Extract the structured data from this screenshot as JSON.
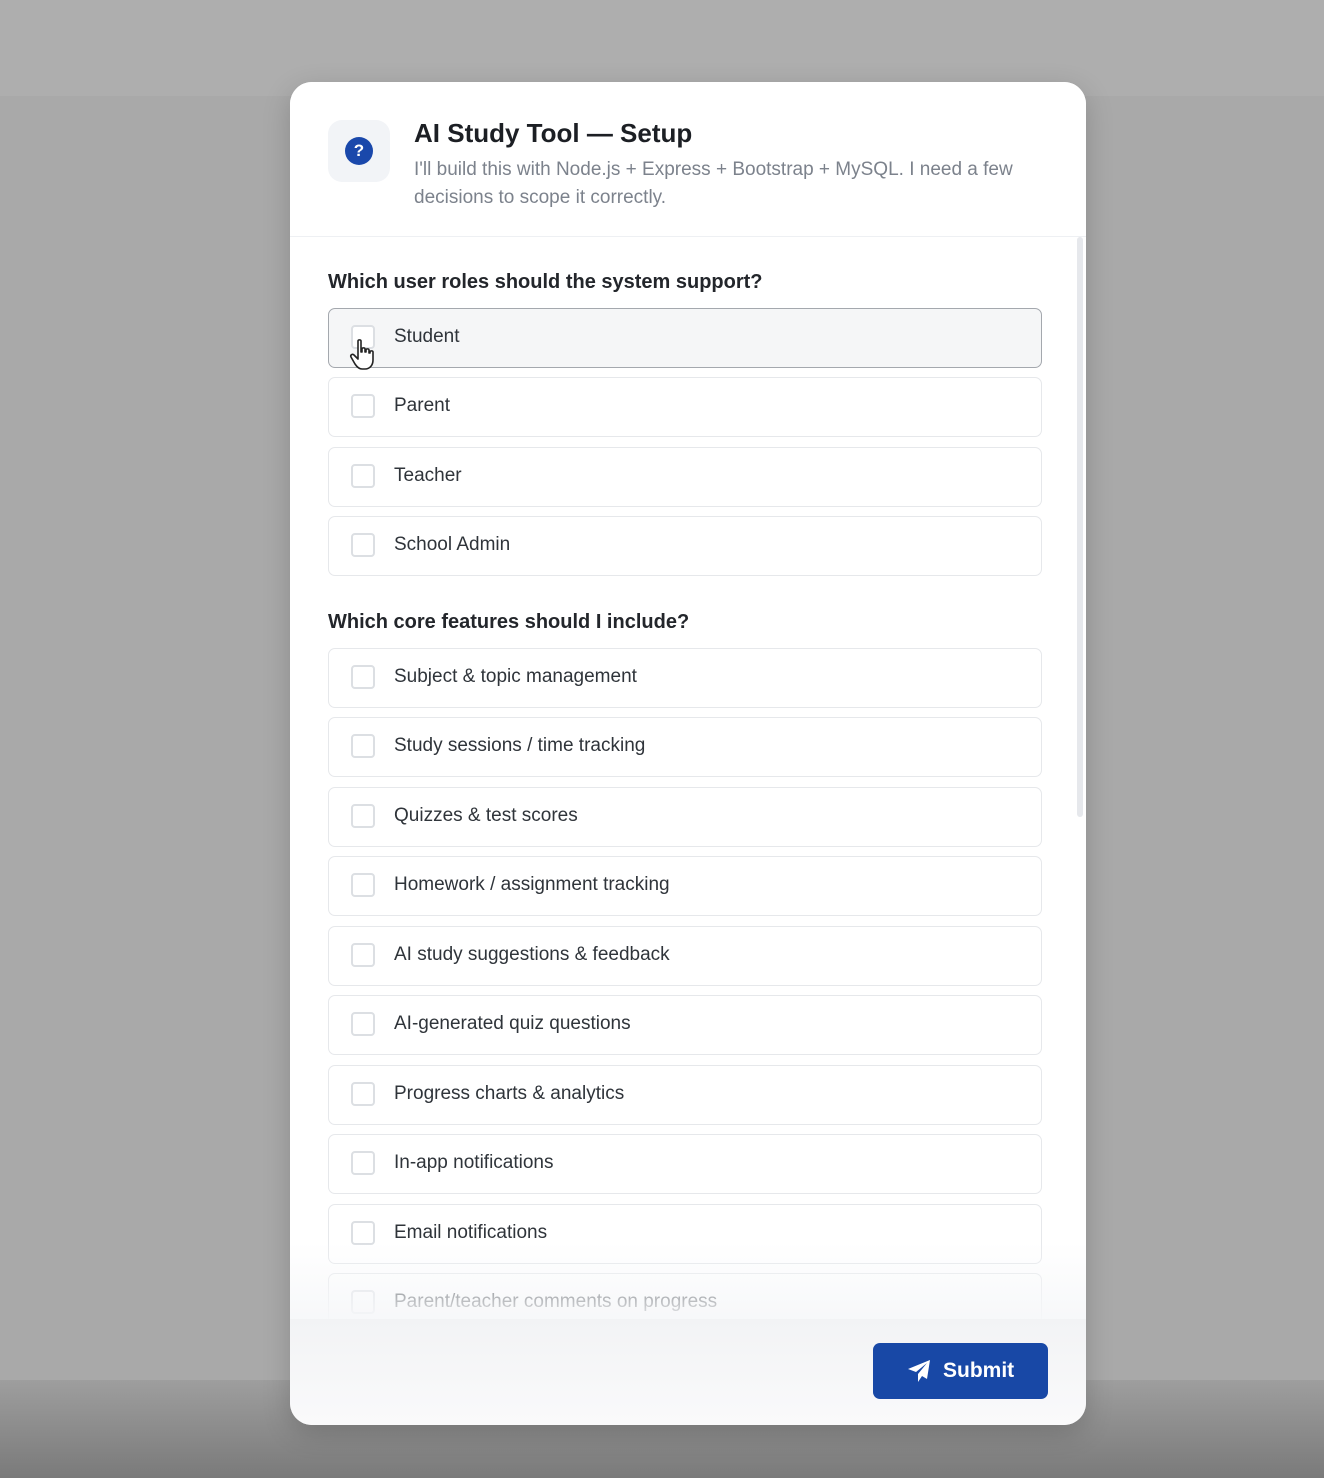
{
  "dialog": {
    "title": "AI Study Tool — Setup",
    "subtitle": "I'll build this with Node.js + Express + Bootstrap + MySQL. I need a few decisions to scope it correctly.",
    "icon": "question-circle-icon",
    "accent_color": "#1848a6"
  },
  "questions": [
    {
      "text": "Which user roles should the system support?",
      "options": [
        {
          "label": "Student",
          "checked": false
        },
        {
          "label": "Parent",
          "checked": false
        },
        {
          "label": "Teacher",
          "checked": false
        },
        {
          "label": "School Admin",
          "checked": false
        }
      ]
    },
    {
      "text": "Which core features should I include?",
      "options": [
        {
          "label": "Subject & topic management",
          "checked": false
        },
        {
          "label": "Study sessions / time tracking",
          "checked": false
        },
        {
          "label": "Quizzes & test scores",
          "checked": false
        },
        {
          "label": "Homework / assignment tracking",
          "checked": false
        },
        {
          "label": "AI study suggestions & feedback",
          "checked": false
        },
        {
          "label": "AI-generated quiz questions",
          "checked": false
        },
        {
          "label": "Progress charts & analytics",
          "checked": false
        },
        {
          "label": "In-app notifications",
          "checked": false
        },
        {
          "label": "Email notifications",
          "checked": false
        },
        {
          "label": "Parent/teacher comments on progress",
          "checked": false
        }
      ]
    }
  ],
  "footer": {
    "submit_label": "Submit",
    "submit_icon": "send-icon"
  }
}
